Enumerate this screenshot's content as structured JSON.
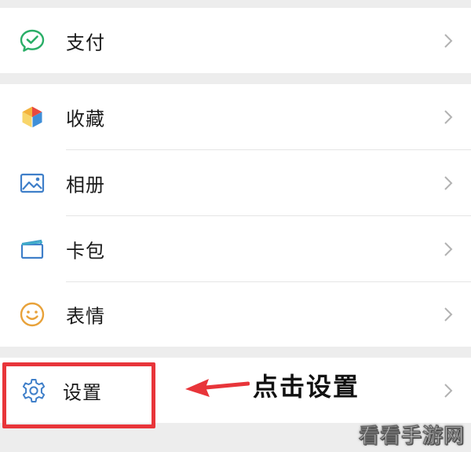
{
  "groups": [
    {
      "items": [
        {
          "label": "支付",
          "icon": "wechat-pay-icon"
        }
      ]
    },
    {
      "items": [
        {
          "label": "收藏",
          "icon": "favorites-cube-icon"
        },
        {
          "label": "相册",
          "icon": "photo-album-icon"
        },
        {
          "label": "卡包",
          "icon": "card-wallet-icon"
        },
        {
          "label": "表情",
          "icon": "smiley-face-icon"
        }
      ]
    },
    {
      "items": [
        {
          "label": "设置",
          "icon": "gear-icon"
        }
      ]
    }
  ],
  "annotation": {
    "text": "点击设置",
    "color": "#e8353a"
  },
  "watermark": "看看手游网",
  "colors": {
    "background": "#ededed",
    "row": "#ffffff",
    "chevron": "#b2b2b2",
    "pay_green": "#2aae67",
    "icon_blue": "#3f7fc9",
    "smiley_orange": "#e8a23a"
  }
}
